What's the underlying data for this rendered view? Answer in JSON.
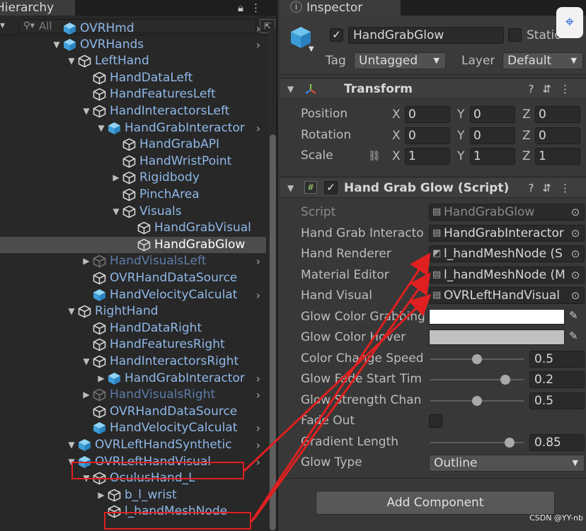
{
  "hierarchy": {
    "tab_label": "Hierarchy",
    "search_placeholder": "All",
    "items": [
      {
        "label": "OVRHmd",
        "depth": 1,
        "arrow": "",
        "icon": "prefab-cube-icon",
        "kind": "prefab",
        "chevron": true
      },
      {
        "label": "OVRHands",
        "depth": 1,
        "arrow": "down",
        "icon": "prefab-cube-icon",
        "kind": "prefab",
        "chevron": true
      },
      {
        "label": "LeftHand",
        "depth": 2,
        "arrow": "down",
        "icon": "gameobject-cube-icon",
        "kind": "normal",
        "chevron": false
      },
      {
        "label": "HandDataLeft",
        "depth": 3,
        "arrow": "",
        "icon": "gameobject-cube-icon",
        "kind": "normal",
        "chevron": false
      },
      {
        "label": "HandFeaturesLeft",
        "depth": 3,
        "arrow": "",
        "icon": "gameobject-cube-icon",
        "kind": "normal",
        "chevron": false
      },
      {
        "label": "HandInteractorsLeft",
        "depth": 3,
        "arrow": "down",
        "icon": "gameobject-cube-icon",
        "kind": "normal",
        "chevron": false
      },
      {
        "label": "HandGrabInteractor",
        "depth": 4,
        "arrow": "down",
        "icon": "prefab-cube-icon",
        "kind": "prefab",
        "chevron": true
      },
      {
        "label": "HandGrabAPI",
        "depth": 5,
        "arrow": "",
        "icon": "gameobject-cube-icon",
        "kind": "normal",
        "chevron": false
      },
      {
        "label": "HandWristPoint",
        "depth": 5,
        "arrow": "",
        "icon": "gameobject-cube-icon",
        "kind": "normal",
        "chevron": false
      },
      {
        "label": "Rigidbody",
        "depth": 5,
        "arrow": "right",
        "icon": "gameobject-cube-icon",
        "kind": "normal",
        "chevron": false
      },
      {
        "label": "PinchArea",
        "depth": 5,
        "arrow": "",
        "icon": "gameobject-cube-icon",
        "kind": "normal",
        "chevron": false
      },
      {
        "label": "Visuals",
        "depth": 5,
        "arrow": "down",
        "icon": "gameobject-cube-icon",
        "kind": "normal",
        "chevron": false
      },
      {
        "label": "HandGrabVisual",
        "depth": 6,
        "arrow": "",
        "icon": "gameobject-cube-icon",
        "kind": "normal",
        "chevron": false
      },
      {
        "label": "HandGrabGlow",
        "depth": 6,
        "arrow": "",
        "icon": "gameobject-cube-icon",
        "kind": "selected",
        "chevron": false
      },
      {
        "label": "HandVisualsLeft",
        "depth": 3,
        "arrow": "right",
        "icon": "gameobject-cube-icon",
        "kind": "disabled",
        "chevron": true
      },
      {
        "label": "OVRHandDataSource",
        "depth": 3,
        "arrow": "",
        "icon": "gameobject-cube-icon",
        "kind": "normal",
        "chevron": false
      },
      {
        "label": "HandVelocityCalculat",
        "depth": 3,
        "arrow": "",
        "icon": "prefab-cube-icon",
        "kind": "prefab",
        "chevron": true
      },
      {
        "label": "RightHand",
        "depth": 2,
        "arrow": "down",
        "icon": "gameobject-cube-icon",
        "kind": "normal",
        "chevron": false
      },
      {
        "label": "HandDataRight",
        "depth": 3,
        "arrow": "",
        "icon": "gameobject-cube-icon",
        "kind": "normal",
        "chevron": false
      },
      {
        "label": "HandFeaturesRight",
        "depth": 3,
        "arrow": "",
        "icon": "gameobject-cube-icon",
        "kind": "normal",
        "chevron": false
      },
      {
        "label": "HandInteractorsRight",
        "depth": 3,
        "arrow": "down",
        "icon": "gameobject-cube-icon",
        "kind": "normal",
        "chevron": false
      },
      {
        "label": "HandGrabInteractor",
        "depth": 4,
        "arrow": "right",
        "icon": "prefab-cube-icon",
        "kind": "prefab",
        "chevron": true
      },
      {
        "label": "HandVisualsRight",
        "depth": 3,
        "arrow": "right",
        "icon": "gameobject-cube-icon",
        "kind": "disabled",
        "chevron": true
      },
      {
        "label": "OVRHandDataSource",
        "depth": 3,
        "arrow": "",
        "icon": "gameobject-cube-icon",
        "kind": "normal",
        "chevron": false
      },
      {
        "label": "HandVelocityCalculat",
        "depth": 3,
        "arrow": "",
        "icon": "prefab-cube-icon",
        "kind": "prefab",
        "chevron": true
      },
      {
        "label": "OVRLeftHandSynthetic",
        "depth": 2,
        "arrow": "down",
        "icon": "prefab-cube-icon",
        "kind": "prefab",
        "chevron": true
      },
      {
        "label": "OVRLeftHandVisual",
        "depth": 2,
        "arrow": "down",
        "icon": "prefab-cube-icon",
        "kind": "prefab",
        "chevron": true,
        "highlight": true
      },
      {
        "label": "OculusHand_L",
        "depth": 3,
        "arrow": "down",
        "icon": "gameobject-cube-icon",
        "kind": "normal",
        "chevron": false
      },
      {
        "label": "b_l_wrist",
        "depth": 4,
        "arrow": "right",
        "icon": "gameobject-cube-icon",
        "kind": "normal",
        "chevron": false
      },
      {
        "label": "l_handMeshNode",
        "depth": 4,
        "arrow": "",
        "icon": "gameobject-cube-icon",
        "kind": "normal",
        "chevron": false,
        "highlight": true
      }
    ]
  },
  "inspector": {
    "tab_label": "Inspector",
    "object_name": "HandGrabGlow",
    "active": true,
    "static_label": "Static",
    "tag_label": "Tag",
    "tag_value": "Untagged",
    "layer_label": "Layer",
    "layer_value": "Default",
    "transform": {
      "title": "Transform",
      "rows": [
        {
          "label": "Position",
          "x": "0",
          "y": "0",
          "z": "0"
        },
        {
          "label": "Rotation",
          "x": "0",
          "y": "0",
          "z": "0"
        },
        {
          "label": "Scale",
          "x": "1",
          "y": "1",
          "z": "1"
        }
      ]
    },
    "script": {
      "title": "Hand Grab Glow (Script)",
      "enabled": true,
      "props": [
        {
          "label": "Script",
          "type": "object",
          "value": "HandGrabGlow",
          "readonly": true,
          "icon": "script-icon"
        },
        {
          "label": "Hand Grab Interacto",
          "type": "object",
          "value": "HandGrabInteractor",
          "icon": "script-icon"
        },
        {
          "label": "Hand Renderer",
          "type": "object",
          "value": "l_handMeshNode (S",
          "icon": "mesh-renderer-icon"
        },
        {
          "label": "Material Editor",
          "type": "object",
          "value": "l_handMeshNode (M",
          "icon": "script-icon"
        },
        {
          "label": "Hand Visual",
          "type": "object",
          "value": "OVRLeftHandVisual",
          "icon": "script-icon"
        },
        {
          "label": "Glow Color Grabbing",
          "type": "color",
          "color": "#ffffff"
        },
        {
          "label": "Glow Color Hover",
          "type": "color",
          "color": "#c0c0c0"
        },
        {
          "label": "Color Change Speed",
          "type": "slider",
          "value": "0.5",
          "fraction": 0.5
        },
        {
          "label": "Glow Fade Start Tim",
          "type": "slider",
          "value": "0.2",
          "fraction": 0.8
        },
        {
          "label": "Glow Strength Chan",
          "type": "slider",
          "value": "0.5",
          "fraction": 0.5
        },
        {
          "label": "Fade Out",
          "type": "toggle",
          "checked": false
        },
        {
          "label": "Gradient Length",
          "type": "slider",
          "value": "0.85",
          "fraction": 0.85
        },
        {
          "label": "Glow Type",
          "type": "dropdown",
          "value": "Outline"
        }
      ]
    },
    "add_component_label": "Add Component"
  },
  "watermark": "CSDN @YY-nb",
  "colors": {
    "accent_red": "#e02020",
    "prefab_blue": "#8fb8e8"
  }
}
